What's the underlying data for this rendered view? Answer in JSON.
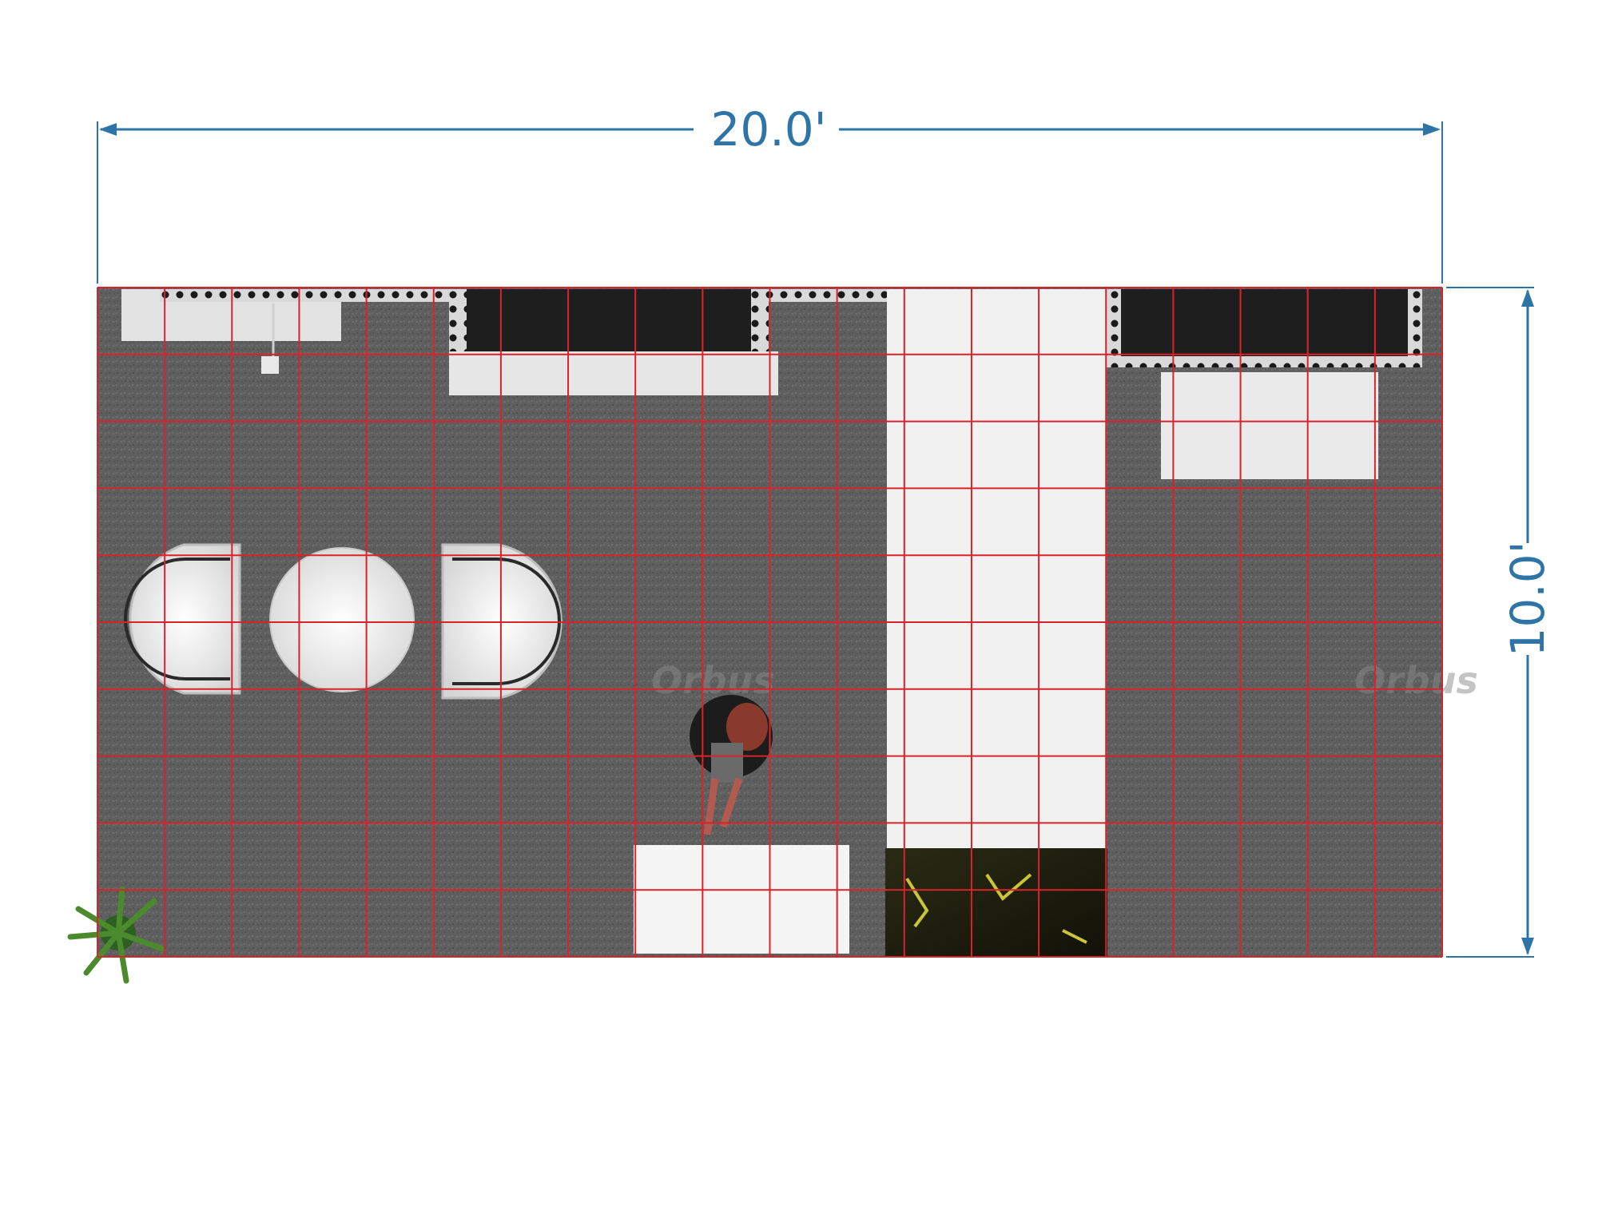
{
  "dimensions": {
    "width_label": "20.0'",
    "depth_label": "10.0'"
  },
  "plan": {
    "width_ft": 20,
    "depth_ft": 10,
    "grid_cell_ft": 1,
    "carpet_color": "#5f5f5f",
    "grid_color": "#d8232a",
    "dimension_color": "#2e74a6"
  },
  "watermark": "Orbus"
}
